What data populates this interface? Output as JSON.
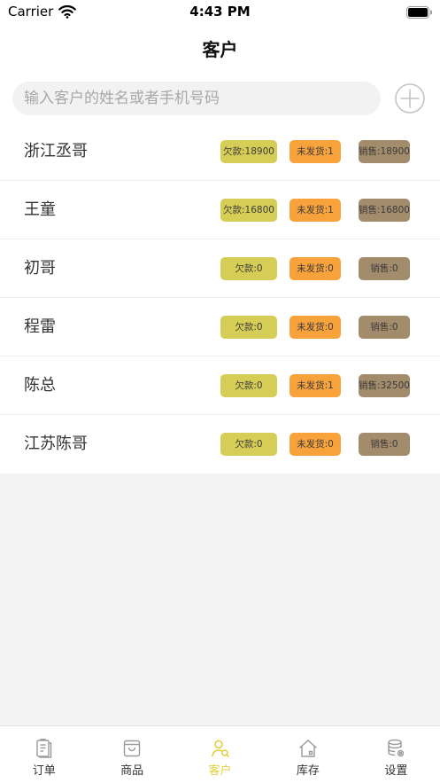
{
  "status_bar": {
    "carrier": "Carrier",
    "time": "4:43 PM",
    "wifi_icon": "wifi-icon",
    "battery_icon": "battery-icon"
  },
  "header": {
    "title": "客户"
  },
  "search": {
    "placeholder": "输入客户的姓名或者手机号码",
    "value": "",
    "add_icon": "plus-circle-icon"
  },
  "colors": {
    "debt_badge": "#d5cd55",
    "unshipped_badge": "#f8a23c",
    "sales_badge": "#a38c6b",
    "active_tab": "#e2cf3c",
    "inactive_tab": "#333333"
  },
  "customers": [
    {
      "name": "浙江丞哥",
      "debt": "欠款:18900",
      "unshipped": "未发货:1",
      "sales": "销售:18900"
    },
    {
      "name": "王童",
      "debt": "欠款:16800",
      "unshipped": "未发货:1",
      "sales": "销售:16800"
    },
    {
      "name": "初哥",
      "debt": "欠款:0",
      "unshipped": "未发货:0",
      "sales": "销售:0"
    },
    {
      "name": "程雷",
      "debt": "欠款:0",
      "unshipped": "未发货:0",
      "sales": "销售:0"
    },
    {
      "name": "陈总",
      "debt": "欠款:0",
      "unshipped": "未发货:1",
      "sales": "销售:32500"
    },
    {
      "name": "江苏陈哥",
      "debt": "欠款:0",
      "unshipped": "未发货:0",
      "sales": "销售:0"
    }
  ],
  "tab_bar": {
    "tabs": [
      {
        "label": "订单",
        "icon": "order-icon",
        "active": false
      },
      {
        "label": "商品",
        "icon": "product-icon",
        "active": false
      },
      {
        "label": "客户",
        "icon": "customer-icon",
        "active": true
      },
      {
        "label": "库存",
        "icon": "inventory-icon",
        "active": false
      },
      {
        "label": "设置",
        "icon": "settings-icon",
        "active": false
      }
    ]
  }
}
